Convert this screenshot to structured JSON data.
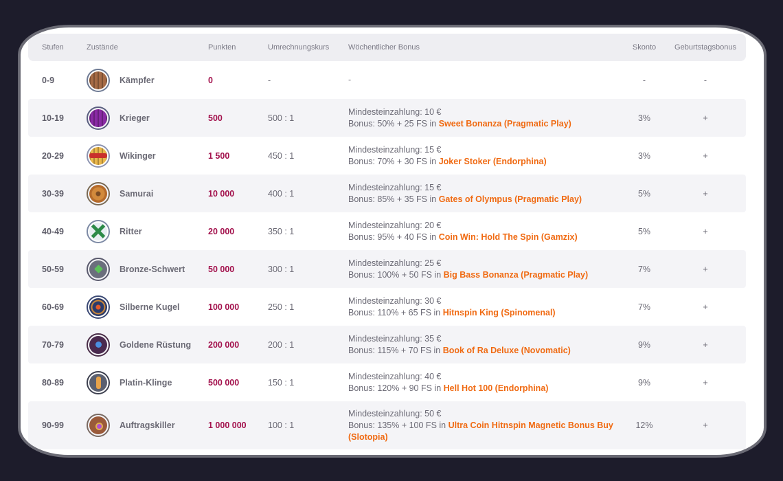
{
  "headers": {
    "levels": "Stufen",
    "states": "Zustände",
    "points": "Punkten",
    "rate": "Umrechnungskurs",
    "weekly": "Wöchentlicher Bonus",
    "discount": "Skonto",
    "birthday": "Geburtstagsbonus"
  },
  "rows": [
    {
      "level": "0-9",
      "name": "Kämpfer",
      "icon": "wooden-shield-icon",
      "points": "0",
      "rate": "-",
      "min": "-",
      "bonus_prefix": "",
      "game": "",
      "discount": "-",
      "birthday": "-"
    },
    {
      "level": "10-19",
      "name": "Krieger",
      "icon": "purple-shield-icon",
      "points": "500",
      "rate": "500 : 1",
      "min": "Mindesteinzahlung: 10 €",
      "bonus_prefix": "Bonus: 50% + 25 FS in ",
      "game": "Sweet Bonanza (Pragmatic Play)",
      "discount": "3%",
      "birthday": "+"
    },
    {
      "level": "20-29",
      "name": "Wikinger",
      "icon": "viking-shield-icon",
      "points": "1 500",
      "rate": "450 : 1",
      "min": "Mindesteinzahlung: 15 €",
      "bonus_prefix": "Bonus: 70% + 30 FS in ",
      "game": "Joker Stoker (Endorphina)",
      "discount": "3%",
      "birthday": "+"
    },
    {
      "level": "30-39",
      "name": "Samurai",
      "icon": "samurai-shield-icon",
      "points": "10 000",
      "rate": "400 : 1",
      "min": "Mindesteinzahlung: 15 €",
      "bonus_prefix": "Bonus: 85% + 35 FS in ",
      "game": "Gates of Olympus (Pragmatic Play)",
      "discount": "5%",
      "birthday": "+"
    },
    {
      "level": "40-49",
      "name": "Ritter",
      "icon": "knight-shield-icon",
      "points": "20 000",
      "rate": "350 : 1",
      "min": "Mindesteinzahlung: 20 €",
      "bonus_prefix": "Bonus: 95% + 40 FS in ",
      "game": "Coin Win: Hold The Spin (Gamzix)",
      "discount": "5%",
      "birthday": "+"
    },
    {
      "level": "50-59",
      "name": "Bronze-Schwert",
      "icon": "bronze-sword-shield-icon",
      "points": "50 000",
      "rate": "300 : 1",
      "min": "Mindesteinzahlung: 25 €",
      "bonus_prefix": "Bonus: 100% + 50 FS in ",
      "game": "Big Bass Bonanza (Pragmatic Play)",
      "discount": "7%",
      "birthday": "+"
    },
    {
      "level": "60-69",
      "name": "Silberne Kugel",
      "icon": "silver-ball-shield-icon",
      "points": "100 000",
      "rate": "250 : 1",
      "min": "Mindesteinzahlung: 30 €",
      "bonus_prefix": "Bonus: 110% + 65 FS in ",
      "game": "Hitnspin King (Spinomenal)",
      "discount": "7%",
      "birthday": "+"
    },
    {
      "level": "70-79",
      "name": "Goldene Rüstung",
      "icon": "golden-armor-shield-icon",
      "points": "200 000",
      "rate": "200 : 1",
      "min": "Mindesteinzahlung: 35 €",
      "bonus_prefix": "Bonus: 115% + 70 FS in ",
      "game": "Book of Ra Deluxe (Novomatic)",
      "discount": "9%",
      "birthday": "+"
    },
    {
      "level": "80-89",
      "name": "Platin-Klinge",
      "icon": "platinum-blade-shield-icon",
      "points": "500 000",
      "rate": "150 : 1",
      "min": "Mindesteinzahlung: 40 €",
      "bonus_prefix": "Bonus: 120% + 90 FS in ",
      "game": "Hell Hot 100 (Endorphina)",
      "discount": "9%",
      "birthday": "+"
    },
    {
      "level": "90-99",
      "name": "Auftragskiller",
      "icon": "assassin-shield-icon",
      "points": "1 000 000",
      "rate": "100 : 1",
      "min": "Mindesteinzahlung: 50 €",
      "bonus_prefix": "Bonus: 135% + 100 FS in ",
      "game": "Ultra Coin Hitnspin Magnetic Bonus Buy (Slotopia)",
      "discount": "12%",
      "birthday": "+"
    }
  ]
}
